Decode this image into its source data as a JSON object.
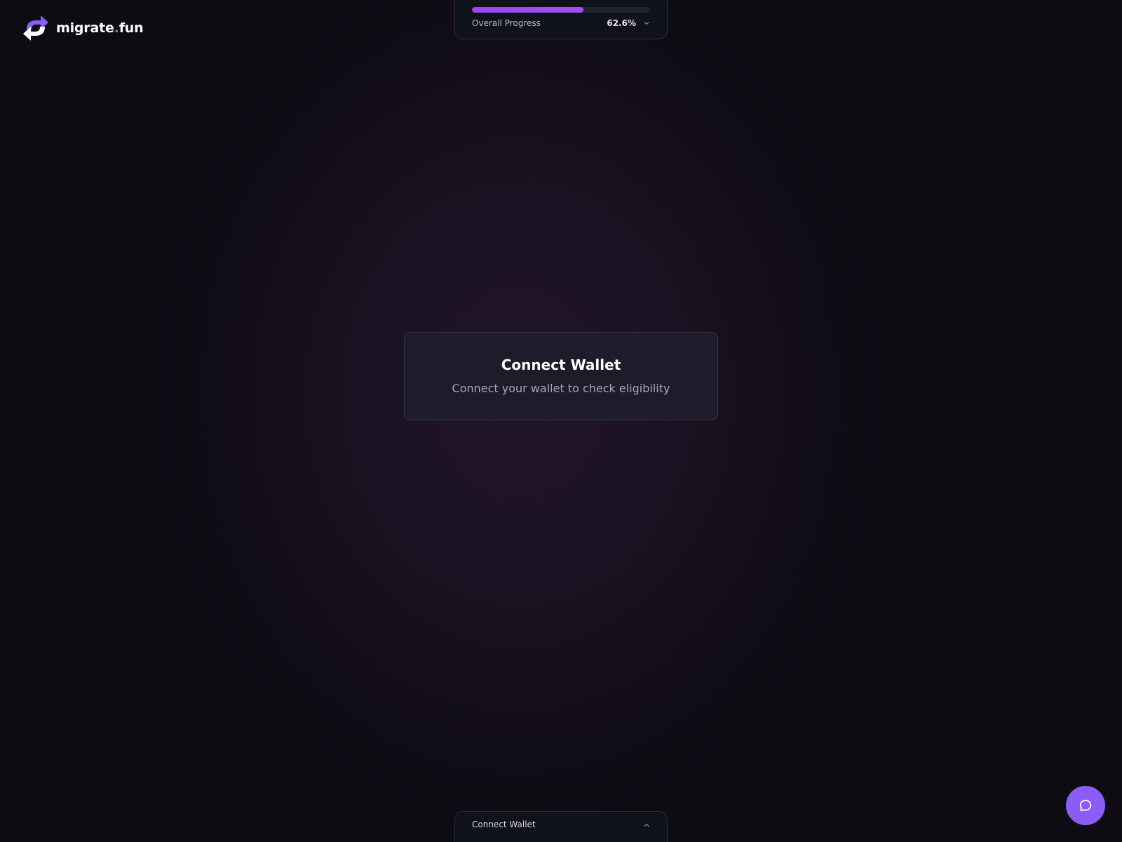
{
  "brand": {
    "name_main": "migrate",
    "name_dot": ".",
    "name_tld": "fun",
    "accent_color": "#8b5cf6"
  },
  "progress": {
    "label": "Overall Progress",
    "value_text": "62.6%",
    "percent": 62.6,
    "icon": "chevron-down-icon"
  },
  "wallet_card": {
    "title": "Connect Wallet",
    "subtitle": "Connect your wallet to check eligibility"
  },
  "bottom_bar": {
    "label": "Connect Wallet",
    "icon": "chevron-up-icon"
  },
  "chat": {
    "icon": "chat-bubble-icon",
    "color": "#8b5cf6"
  }
}
